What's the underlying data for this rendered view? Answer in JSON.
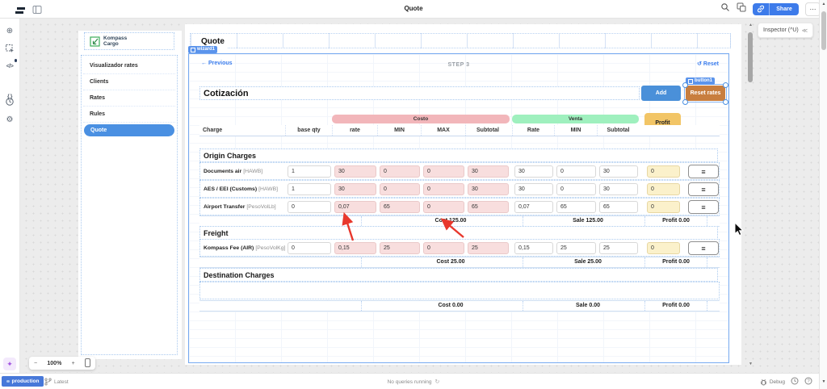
{
  "topbar": {
    "title": "Quote",
    "share": "Share",
    "more": "⋯"
  },
  "inspector": {
    "label": "Inspector (^U)",
    "collapse": "≪"
  },
  "zoombar": {
    "minus": "−",
    "level": "100%",
    "plus": "+"
  },
  "sidebar": {
    "logo": "Kompass Cargo",
    "items": [
      "Visualizador rates",
      "Clients",
      "Rates",
      "Rules",
      "Quote"
    ],
    "active_item": "Quote"
  },
  "canvas": {
    "page_title": "Quote",
    "widget_badge": "wizard1"
  },
  "wizard": {
    "previous": "← Previous",
    "step": "STEP 3",
    "reset": "↺ Reset",
    "heading": "Cotización",
    "add": "Add",
    "reset_rates": "Reset rates",
    "button_badge": "button1",
    "groups": {
      "cost": "Costo",
      "sale": "Venta",
      "profit": "Profit"
    },
    "columns": {
      "charge": "Charge",
      "base_qty": "base qty",
      "rate": "rate",
      "min": "MIN",
      "max": "MAX",
      "subtotal": "Subtotal",
      "sale_rate": "Rate",
      "sale_min": "MIN",
      "sale_subtotal": "Subtotal"
    },
    "sections": [
      {
        "title": "Origin Charges",
        "rows": [
          {
            "name": "Documents air",
            "unit": "[HAWB]",
            "base_qty": "1",
            "rate": "30",
            "min": "0",
            "max": "0",
            "subtotal": "30",
            "sale_rate": "30",
            "sale_min": "0",
            "sale_subtotal": "30",
            "profit": "0"
          },
          {
            "name": "AES / EEI (Customs)",
            "unit": "[HAWB]",
            "base_qty": "1",
            "rate": "30",
            "min": "0",
            "max": "0",
            "subtotal": "30",
            "sale_rate": "30",
            "sale_min": "0",
            "sale_subtotal": "30",
            "profit": "0"
          },
          {
            "name": "Airport Transfer",
            "unit": "[PesoVolLb]",
            "base_qty": "0",
            "rate": "0,07",
            "min": "65",
            "max": "0",
            "subtotal": "65",
            "sale_rate": "0,07",
            "sale_min": "65",
            "sale_subtotal": "65",
            "profit": "0"
          }
        ],
        "totals": {
          "cost": "Cost 125.00",
          "sale": "Sale 125.00",
          "profit": "Profit 0.00"
        }
      },
      {
        "title": "Freight",
        "rows": [
          {
            "name": "Kompass Fee (AIR)",
            "unit": "[PesoVolKg]",
            "base_qty": "0",
            "rate": "0,15",
            "min": "25",
            "max": "0",
            "subtotal": "25",
            "sale_rate": "0,15",
            "sale_min": "25",
            "sale_subtotal": "25",
            "profit": "0"
          }
        ],
        "totals": {
          "cost": "Cost 25.00",
          "sale": "Sale 25.00",
          "profit": "Profit 0.00"
        }
      },
      {
        "title": "Destination Charges",
        "rows": [],
        "totals": {
          "cost": "Cost 0.00",
          "sale": "Sale 0.00",
          "profit": "Profit 0.00"
        }
      }
    ]
  },
  "statusbar": {
    "env": "production",
    "branch": "Latest",
    "queries": "No queries running",
    "debug": "Debug"
  },
  "icons": {
    "row_menu": "≡",
    "scroll_up": "▲",
    "scroll_down": "▼",
    "sparkle": "✦",
    "refresh": "↻",
    "plus_circle": "⊕",
    "gear": "⚙"
  },
  "colors": {
    "accent_blue": "#3D7BEA",
    "nav_active": "#4A90E2",
    "badge_blue": "#5B94EC",
    "add_button": "#4A90D9",
    "reset_rates_button": "#C87E3F",
    "cost_group": "#F2B6BA",
    "sale_group": "#9FF0BE",
    "profit_header": "#F2C566",
    "cost_input": "#F8DEDE",
    "profit_cell": "#FBF1CB",
    "annotation_red": "#E8382D"
  }
}
